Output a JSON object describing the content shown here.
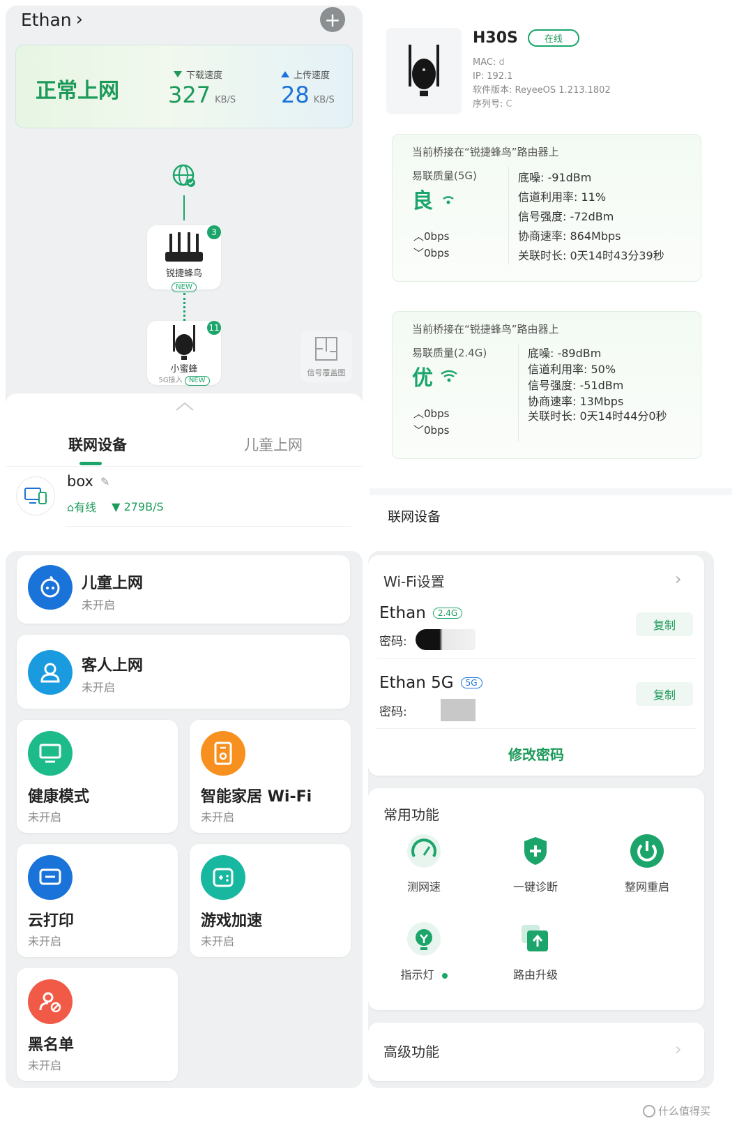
{
  "q1": {
    "user": "Ethan",
    "chevron": "›",
    "add_icon": "+",
    "status": "正常上网",
    "download_label": "下载速度",
    "download_value": "327",
    "download_unit": "KB/S",
    "upload_label": "上传速度",
    "upload_value": "28",
    "upload_unit": "KB/S",
    "router1_name": "锐捷蜂鸟",
    "router1_badge": "3",
    "router1_tag": "NEW",
    "router2_name": "小蜜蜂",
    "router2_sub": "5G接入",
    "router2_badge": "11",
    "router2_tag": "NEW",
    "coverage_label": "信号覆盖图",
    "tab_devices": "联网设备",
    "tab_kids": "儿童上网",
    "device_name": "box",
    "device_conn": "有线",
    "device_speed": "279B/S"
  },
  "q2": {
    "model": "H30S",
    "status": "在线",
    "mac_label": "MAC:",
    "ip_label": "IP:",
    "ip_value": "192.1",
    "fw_label": "软件版本:",
    "fw_value": "ReyeeOS 1.213.1802",
    "sn_label": "序列号:",
    "cards": [
      {
        "title": "当前桥接在“锐捷蜂鸟”路由器上",
        "quality_label": "易联质量(5G)",
        "quality_value": "良",
        "up": "0bps",
        "down": "0bps",
        "noise": "底噪: -91dBm",
        "util": "信道利用率: 11%",
        "signal": "信号强度: -72dBm",
        "rate": "协商速率: 864Mbps",
        "duration": "关联时长: 0天14时43分39秒"
      },
      {
        "title": "当前桥接在“锐捷蜂鸟”路由器上",
        "quality_label": "易联质量(2.4G)",
        "quality_value": "优",
        "up": "0bps",
        "down": "0bps",
        "noise": "底噪: -89dBm",
        "util": "信道利用率: 50%",
        "signal": "信号强度: -51dBm",
        "rate": "协商速率: 13Mbps",
        "duration": "关联时长: 0天14时44分0秒"
      }
    ],
    "devices_label": "联网设备"
  },
  "q3": {
    "items": [
      {
        "title": "儿童上网",
        "status": "未开启",
        "color": "#1a73d9",
        "icon": "child-face-icon"
      },
      {
        "title": "客人上网",
        "status": "未开启",
        "color": "#1a9be0",
        "icon": "guest-user-icon"
      },
      {
        "title": "健康模式",
        "status": "未开启",
        "color": "#1dbb8a",
        "icon": "monitor-icon"
      },
      {
        "title": "智能家居 Wi-Fi",
        "status": "未开启",
        "color": "#f7901e",
        "icon": "smart-home-icon"
      },
      {
        "title": "云打印",
        "status": "未开启",
        "color": "#1a73d9",
        "icon": "printer-icon"
      },
      {
        "title": "游戏加速",
        "status": "未开启",
        "color": "#18b7a0",
        "icon": "gamepad-icon"
      },
      {
        "title": "黑名单",
        "status": "未开启",
        "color": "#f05a46",
        "icon": "blacklist-icon"
      }
    ]
  },
  "q4": {
    "wifi_title": "Wi-Fi设置",
    "ssid1": "Ethan",
    "ssid1_tag": "2.4G",
    "ssid2": "Ethan 5G",
    "ssid2_tag": "5G",
    "pwd_label": "密码:",
    "copy_label": "复制",
    "change_pwd": "修改密码",
    "common_title": "常用功能",
    "functions": [
      {
        "label": "测网速",
        "icon": "speedometer-icon"
      },
      {
        "label": "一键诊断",
        "icon": "shield-plus-icon"
      },
      {
        "label": "整网重启",
        "icon": "power-icon"
      },
      {
        "label": "指示灯",
        "icon": "lamp-icon"
      },
      {
        "label": "路由升级",
        "icon": "upgrade-icon"
      }
    ],
    "advanced_title": "高级功能",
    "watermark": "什么值得买"
  }
}
